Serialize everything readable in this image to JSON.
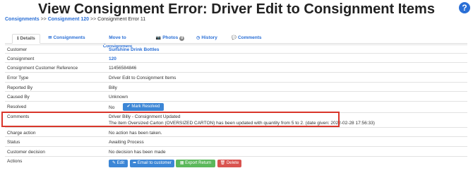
{
  "title": "View Consignment Error: Driver Edit to Consignment Items",
  "help_icon": "?",
  "breadcrumb": {
    "items": [
      "Consignments",
      "Consignment 120"
    ],
    "separator": ">>",
    "current": "Consignment Error 11"
  },
  "tabs": [
    {
      "label": "Details",
      "icon": "info-icon",
      "glyph": "ℹ",
      "active": true
    },
    {
      "label": "Consignments",
      "icon": "envelope-icon",
      "glyph": "✉"
    },
    {
      "label": "Move to Consignment",
      "icon": "",
      "glyph": ""
    },
    {
      "label": "Photos",
      "icon": "camera-icon",
      "glyph": "📷",
      "badge": "0"
    },
    {
      "label": "History",
      "icon": "clock-icon",
      "glyph": "◷"
    },
    {
      "label": "Comments",
      "icon": "comment-icon",
      "glyph": "💬"
    }
  ],
  "rows": {
    "customer": {
      "label": "Customer",
      "value": "Sunshine Drink Bottles"
    },
    "consignment": {
      "label": "Consignment",
      "value": "120"
    },
    "reference": {
      "label": "Consignment Customer Reference",
      "value": "11456584846"
    },
    "error_type": {
      "label": "Error Type",
      "value": "Driver Edit to Consignment Items"
    },
    "reported_by": {
      "label": "Reported By",
      "value": "Billy"
    },
    "caused_by": {
      "label": "Caused By",
      "value": "Unknown"
    },
    "resolved": {
      "label": "Resolved",
      "value": "No",
      "button": "Mark Resolved"
    },
    "comments": {
      "label": "Comments",
      "line1": "Driver Billy - Consignment Updated",
      "line2": "The item Oversized Carton (OVERSIZED CARTON) has been updated with quantity from 5 to 2. (date given: 2022-02-28 17:56:33)"
    },
    "charge_action": {
      "label": "Charge action",
      "value": "No action has been taken."
    },
    "status": {
      "label": "Status",
      "value": "Awaiting Process"
    },
    "customer_decision": {
      "label": "Customer decision",
      "value": "No decision has been made"
    },
    "actions": {
      "label": "Actions",
      "edit": "Edit",
      "email": "Email to customer",
      "export": "Export Return",
      "delete": "Delete"
    }
  },
  "colors": {
    "link": "#2a6fd6",
    "highlight_border": "#d9362b",
    "btn_primary": "#3c86d6",
    "btn_success": "#5cb85c",
    "btn_danger": "#d9534f"
  }
}
